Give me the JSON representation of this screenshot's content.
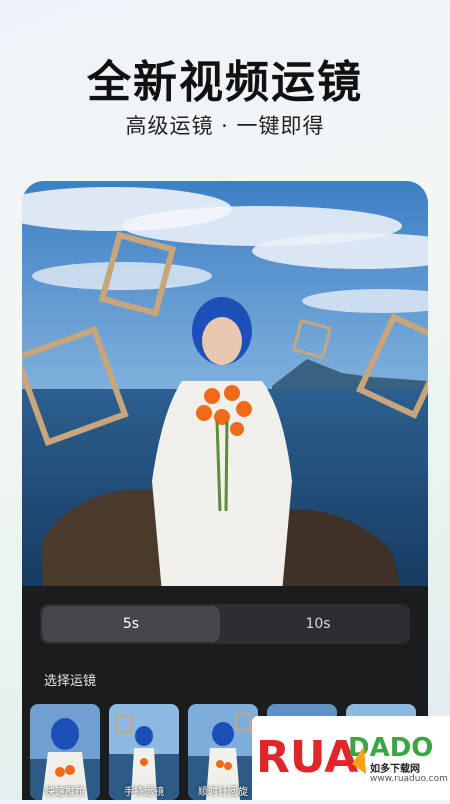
{
  "header": {
    "title": "全新视频运镜",
    "subtitle": "高级运镜 · 一键即得"
  },
  "duration": {
    "options": [
      "5s",
      "10s"
    ],
    "selected": "5s"
  },
  "camera_moves": {
    "label": "选择运镜",
    "items": [
      {
        "label": "快速推拉"
      },
      {
        "label": "手持运镜"
      },
      {
        "label": "顺时针回旋"
      },
      {
        "label": ""
      },
      {
        "label": ""
      }
    ]
  },
  "watermark": {
    "logo": "RUADADO",
    "tagline": "如多下载网",
    "url": "www.ruaduo.com"
  },
  "colors": {
    "accent_red": "#e0262a",
    "accent_green": "#3aa542",
    "panel_bg": "#1b1c1e"
  }
}
